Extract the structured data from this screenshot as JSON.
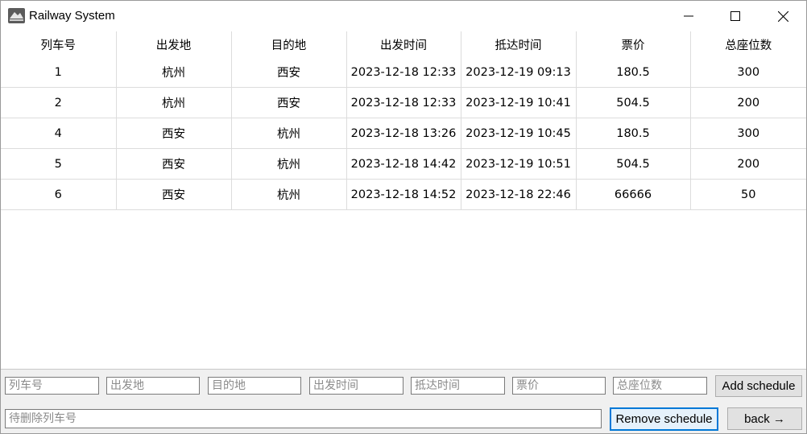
{
  "window": {
    "title": "Railway System"
  },
  "table": {
    "headers": [
      "列车号",
      "出发地",
      "目的地",
      "出发时间",
      "抵达时间",
      "票价",
      "总座位数"
    ],
    "rows": [
      [
        "1",
        "杭州",
        "西安",
        "2023-12-18 12:33",
        "2023-12-19 09:13",
        "180.5",
        "300"
      ],
      [
        "2",
        "杭州",
        "西安",
        "2023-12-18 12:33",
        "2023-12-19 10:41",
        "504.5",
        "200"
      ],
      [
        "4",
        "西安",
        "杭州",
        "2023-12-18 13:26",
        "2023-12-19 10:45",
        "180.5",
        "300"
      ],
      [
        "5",
        "西安",
        "杭州",
        "2023-12-18 14:42",
        "2023-12-19 10:51",
        "504.5",
        "200"
      ],
      [
        "6",
        "西安",
        "杭州",
        "2023-12-18 14:52",
        "2023-12-18 22:46",
        "66666",
        "50"
      ]
    ]
  },
  "form": {
    "train_no_placeholder": "列车号",
    "from_placeholder": "出发地",
    "to_placeholder": "目的地",
    "depart_placeholder": "出发时间",
    "arrive_placeholder": "抵达时间",
    "price_placeholder": "票价",
    "seats_placeholder": "总座位数",
    "add_label": "Add schedule",
    "delete_placeholder": "待删除列车号",
    "remove_label": "Remove schedule",
    "back_label": "back →"
  }
}
